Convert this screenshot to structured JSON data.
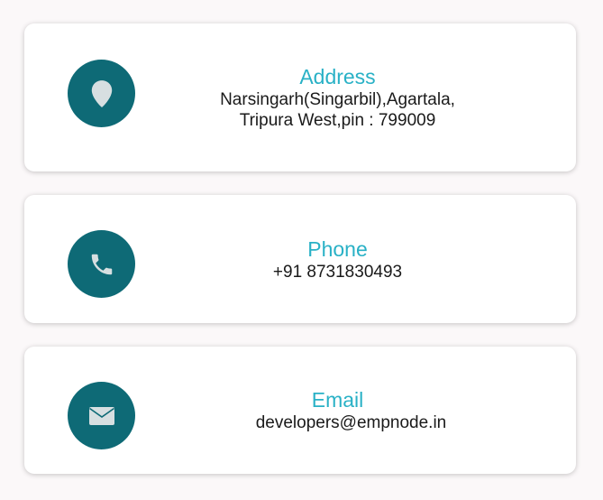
{
  "colors": {
    "icon_background": "#0e6a76",
    "title": "#29b1c6",
    "text": "#1a1a1a",
    "card_background": "#ffffff"
  },
  "contact": {
    "address": {
      "icon": "location-pin-icon",
      "title": "Address",
      "line1": "Narsingarh(Singarbil),Agartala,",
      "line2": "Tripura West,pin : 799009"
    },
    "phone": {
      "icon": "phone-icon",
      "title": "Phone",
      "value": "+91 8731830493"
    },
    "email": {
      "icon": "envelope-icon",
      "title": "Email",
      "value": "developers@empnode.in"
    }
  }
}
